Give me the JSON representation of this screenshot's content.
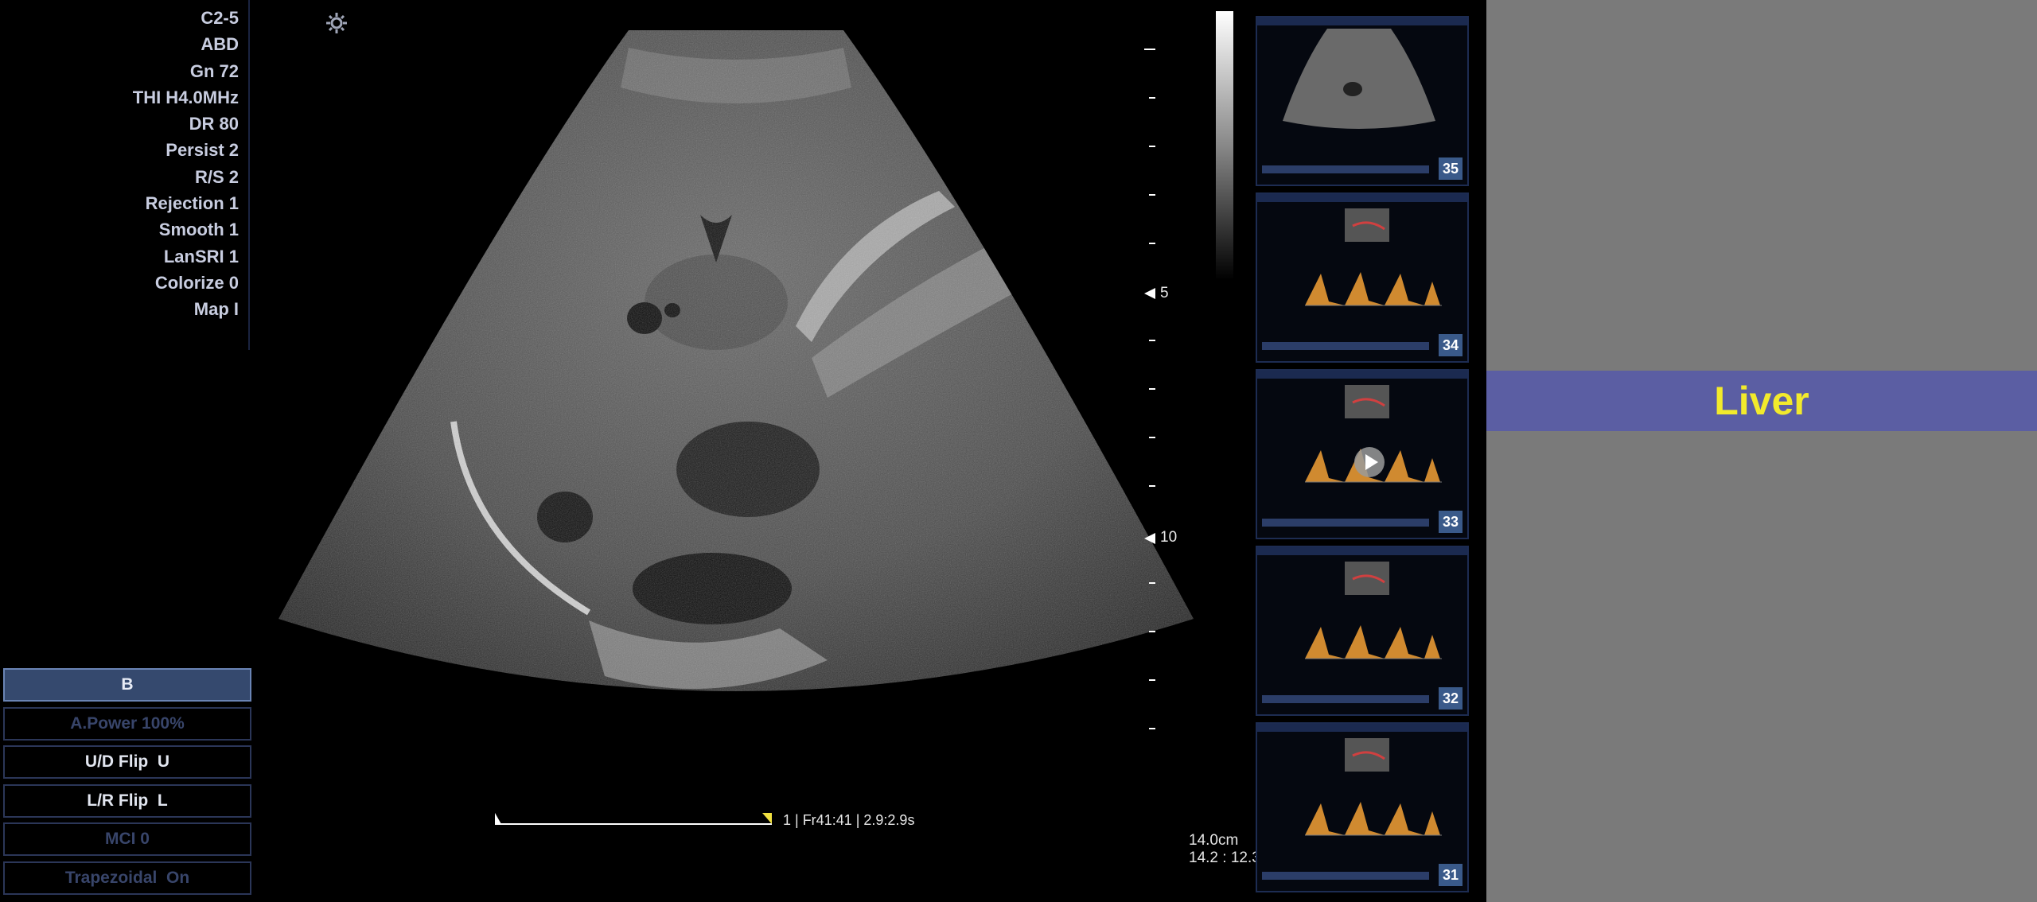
{
  "params": [
    "C2-5",
    "ABD",
    "Gn 72",
    "THI H4.0MHz",
    "DR 80",
    "Persist 2",
    "R/S 2",
    "Rejection 1",
    "Smooth 1",
    "LanSRI 1",
    "Colorize 0",
    "Map I"
  ],
  "menu": [
    {
      "label": "B",
      "state": "active"
    },
    {
      "label": "A.Power 100%",
      "state": "disabled"
    },
    {
      "label": "U/D Flip  U",
      "state": "enabled"
    },
    {
      "label": "L/R Flip  L",
      "state": "enabled"
    },
    {
      "label": "MCI 0",
      "state": "disabled"
    },
    {
      "label": "Trapezoidal  On",
      "state": "disabled"
    }
  ],
  "depth_markers": {
    "mark_5": "5",
    "mark_10": "10"
  },
  "cine": {
    "info": "1 | Fr41:41 | 2.9:2.9s",
    "progress": 1.0
  },
  "depth_readout": {
    "line1": "14.0cm",
    "line2": "14.2 : 12.3"
  },
  "thumbnails": [
    {
      "number": "35",
      "kind": "bmode"
    },
    {
      "number": "34",
      "kind": "doppler"
    },
    {
      "number": "33",
      "kind": "doppler"
    },
    {
      "number": "32",
      "kind": "doppler"
    },
    {
      "number": "31",
      "kind": "doppler"
    }
  ],
  "banner": {
    "label": "Liver"
  },
  "colors": {
    "banner_bg": "#5b5ea3",
    "banner_text": "#f2ea2c",
    "active_btn": "#35496e",
    "doppler": "#d08a30"
  }
}
